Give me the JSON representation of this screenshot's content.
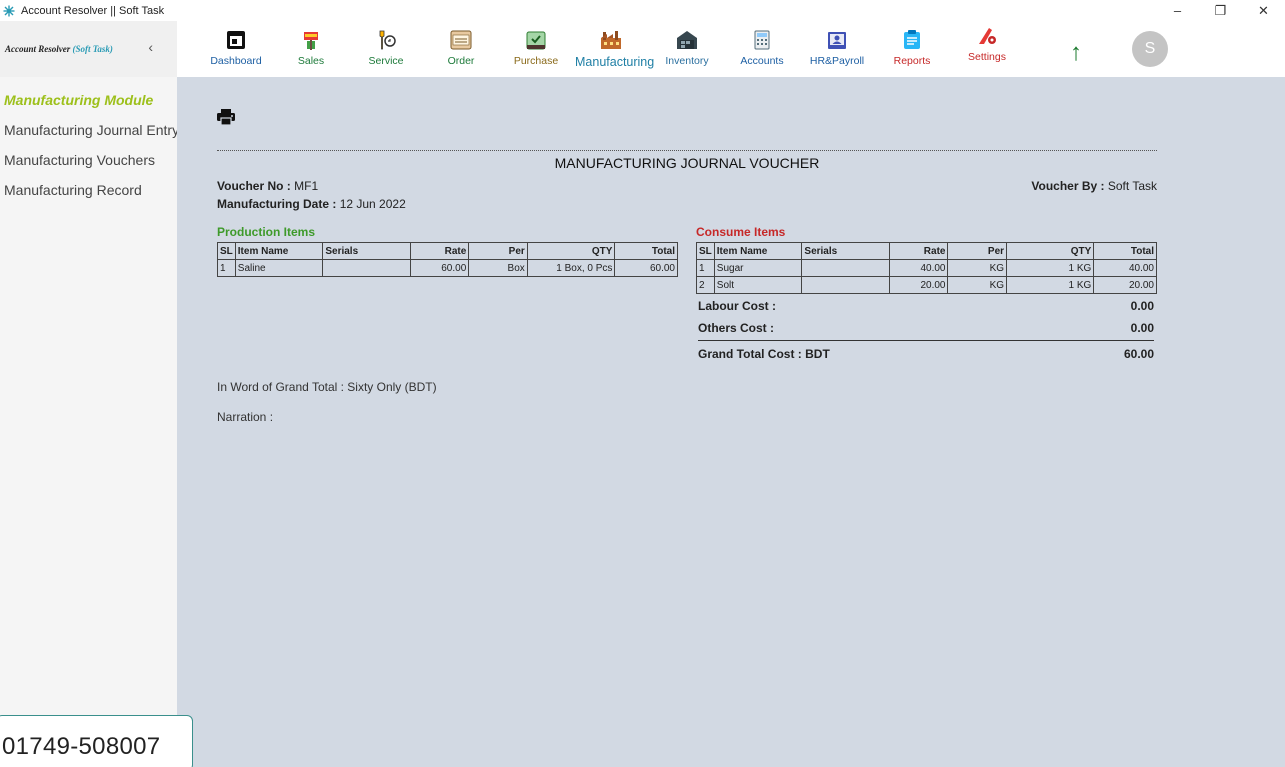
{
  "window": {
    "title": "Account Resolver || Soft Task",
    "minimize": "–",
    "restore": "❐",
    "close": "✕"
  },
  "brand": {
    "name": "Account Resolver",
    "accent": "(Soft Task)",
    "collapse": "‹"
  },
  "nav": [
    {
      "label": "Dashboard",
      "color": "#1d5fa3",
      "icon": "dashboard-icon"
    },
    {
      "label": "Sales",
      "color": "#1d7a3a",
      "icon": "sales-icon"
    },
    {
      "label": "Service",
      "color": "#1d7a3a",
      "icon": "service-icon"
    },
    {
      "label": "Order",
      "color": "#1d7a3a",
      "icon": "order-icon"
    },
    {
      "label": "Purchase",
      "color": "#8a6a1a",
      "icon": "purchase-icon"
    },
    {
      "label": "Manufacturing",
      "color": "#1f7fa5",
      "icon": "manufacturing-icon",
      "active": true
    },
    {
      "label": "Inventory",
      "color": "#2a6f9f",
      "icon": "inventory-icon"
    },
    {
      "label": "Accounts",
      "color": "#1d5fa3",
      "icon": "accounts-icon"
    },
    {
      "label": "HR&Payroll",
      "color": "#1d5fa3",
      "icon": "hr-payroll-icon"
    },
    {
      "label": "Reports",
      "color": "#c62828",
      "icon": "reports-icon"
    },
    {
      "label": "Settings",
      "color": "#c62828",
      "icon": "settings-icon"
    }
  ],
  "user": {
    "up_icon": "↑",
    "avatar_initial": "S"
  },
  "sidebar": {
    "title": "Manufacturing Module",
    "items": [
      {
        "label": "Manufacturing Journal Entry"
      },
      {
        "label": "Manufacturing Vouchers"
      },
      {
        "label": "Manufacturing Record"
      }
    ],
    "phone": "01749-508007"
  },
  "voucher": {
    "title": "MANUFACTURING JOURNAL VOUCHER",
    "no_label": "Voucher No :",
    "no_value": "MF1",
    "date_label": "Manufacturing Date :",
    "date_value": "12 Jun 2022",
    "by_label": "Voucher By :",
    "by_value": "Soft Task",
    "production": {
      "title": "Production Items",
      "headers": [
        "SL",
        "Item Name",
        "Serials",
        "Rate",
        "Per",
        "QTY",
        "Total"
      ],
      "rows": [
        [
          "1",
          "Saline",
          "",
          "60.00",
          "Box",
          "1 Box, 0 Pcs",
          "60.00"
        ]
      ]
    },
    "consume": {
      "title": "Consume Items",
      "headers": [
        "SL",
        "Item Name",
        "Serials",
        "Rate",
        "Per",
        "QTY",
        "Total"
      ],
      "rows": [
        [
          "1",
          "Sugar",
          "",
          "40.00",
          "KG",
          "1 KG",
          "40.00"
        ],
        [
          "2",
          "Solt",
          "",
          "20.00",
          "KG",
          "1 KG",
          "20.00"
        ]
      ]
    },
    "labour_label": "Labour Cost :",
    "labour_value": "0.00",
    "others_label": "Others Cost :",
    "others_value": "0.00",
    "grand_label": "Grand Total Cost : BDT",
    "grand_value": "60.00",
    "in_word": "In Word of Grand Total : Sixty Only (BDT)",
    "narration": "Narration :"
  }
}
